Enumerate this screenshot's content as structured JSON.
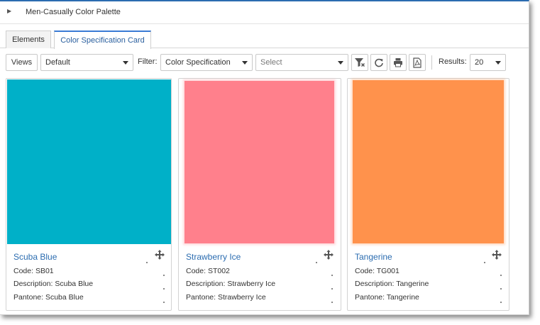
{
  "header": {
    "title": "Men-Casually Color Palette"
  },
  "tabs": [
    {
      "label": "Elements"
    },
    {
      "label": "Color Specification Card"
    }
  ],
  "toolbar": {
    "views_label": "Views",
    "views_value": "Default",
    "filter_label": "Filter:",
    "filter_value": "Color Specification",
    "select_placeholder": "Select",
    "results_label": "Results:",
    "results_value": "20"
  },
  "cards": [
    {
      "name": "Scuba Blue",
      "code_label": "Code:",
      "code": "SB01",
      "description_label": "Description:",
      "description": "Scuba Blue",
      "pantone_label": "Pantone:",
      "pantone": "Scuba Blue",
      "color": "#00b0c8"
    },
    {
      "name": "Strawberry Ice",
      "code_label": "Code:",
      "code": "ST002",
      "description_label": "Description:",
      "description": "Strawberry Ice",
      "pantone_label": "Pantone:",
      "pantone": "Strawberry Ice",
      "color": "#ff808c"
    },
    {
      "name": "Tangerine",
      "code_label": "Code:",
      "code": "TG001",
      "description_label": "Description:",
      "description": "Tangerine",
      "pantone_label": "Pantone:",
      "pantone": "Tangerine",
      "color": "#ff924c"
    }
  ],
  "icons": {
    "expand": "caret-right-icon",
    "clear_filter": "clear-filter-icon",
    "refresh": "refresh-icon",
    "print": "print-icon",
    "pdf": "pdf-icon",
    "move": "move-icon"
  },
  "colors": {
    "accent": "#2b6cb0"
  }
}
